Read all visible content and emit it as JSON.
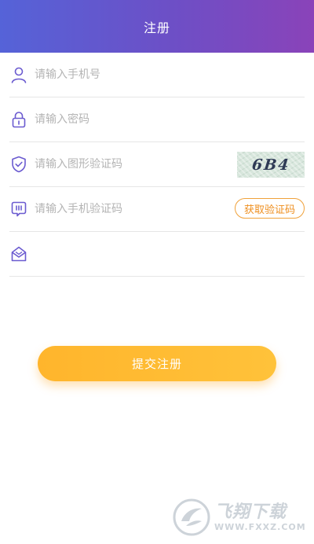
{
  "header": {
    "title": "注册"
  },
  "form": {
    "phone": {
      "placeholder": "请输入手机号",
      "icon": "user-icon"
    },
    "password": {
      "placeholder": "请输入密码",
      "icon": "lock-icon"
    },
    "captcha": {
      "placeholder": "请输入图形验证码",
      "icon": "shield-check-icon",
      "image_text": "6B4"
    },
    "sms_code": {
      "placeholder": "请输入手机验证码",
      "icon": "message-icon",
      "button_label": "获取验证码"
    },
    "invite": {
      "placeholder": "",
      "icon": "invite-envelope-icon"
    }
  },
  "submit": {
    "label": "提交注册"
  },
  "watermark": {
    "title": "飞翔下载",
    "url": "WWW.FXXZ.COM"
  },
  "colors": {
    "header_gradient_start": "#5563d8",
    "header_gradient_end": "#8a43b9",
    "icon_purple": "#6b5bd0",
    "accent_orange": "#ef8f1f",
    "submit_gradient_start": "#ffb52c",
    "submit_gradient_end": "#ffc23a",
    "divider": "#e6e6e6",
    "placeholder_gray": "#b4b4b4"
  }
}
